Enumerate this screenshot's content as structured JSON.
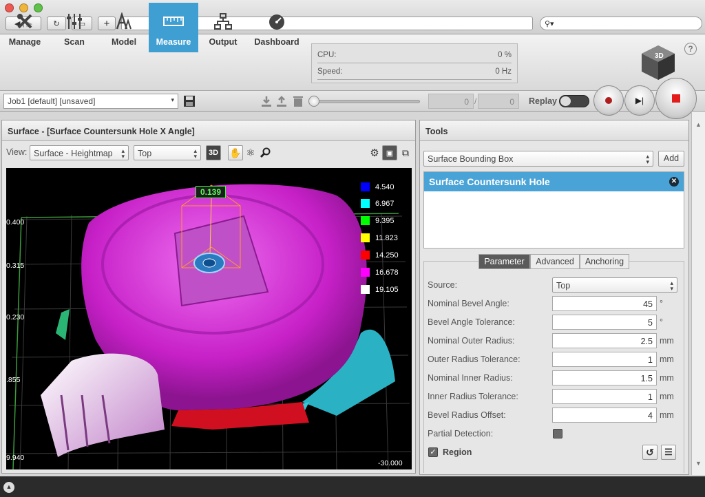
{
  "toolbar": {
    "items": [
      {
        "label": "Manage",
        "icon": "wrench-screwdriver-icon"
      },
      {
        "label": "Scan",
        "icon": "sliders-icon"
      },
      {
        "label": "Model",
        "icon": "font-model-icon"
      },
      {
        "label": "Measure",
        "icon": "ruler-icon"
      },
      {
        "label": "Output",
        "icon": "network-icon"
      },
      {
        "label": "Dashboard",
        "icon": "gauge-icon"
      }
    ],
    "active": "Measure",
    "cpu_label": "CPU:",
    "cpu_value": "0 %",
    "speed_label": "Speed:",
    "speed_value": "0 Hz",
    "help": "?",
    "logo": "3D"
  },
  "jobbar": {
    "job": "Job1 [default] [unsaved]",
    "frame_current": "0",
    "separator": "/",
    "frame_total": "0",
    "replay_label": "Replay"
  },
  "surface_panel": {
    "title": "Surface - [Surface Countersunk Hole X Angle]",
    "view_label": "View:",
    "view_mode": "Surface - Heightmap",
    "view_dir": "Top",
    "btn_3d": "3D",
    "measurement_value": "0.139",
    "legend": [
      {
        "value": "4.540",
        "color": "#0000ff"
      },
      {
        "value": "6.967",
        "color": "#00ffff"
      },
      {
        "value": "9.395",
        "color": "#00ff00"
      },
      {
        "value": "11.823",
        "color": "#ffff00"
      },
      {
        "value": "14.250",
        "color": "#ff0000"
      },
      {
        "value": "16.678",
        "color": "#ff00ff"
      },
      {
        "value": "19.105",
        "color": "#ffffff"
      }
    ],
    "axis_labels": [
      "0.400",
      "0.315",
      "0.230",
      ".855",
      "9.940"
    ],
    "axis_right": "-30.000"
  },
  "tools_panel": {
    "title": "Tools",
    "tool_select": "Surface Bounding Box",
    "add_label": "Add",
    "selected_tool": "Surface Countersunk Hole",
    "tabs": [
      "Parameter",
      "Advanced",
      "Anchoring"
    ],
    "active_tab": "Parameter",
    "source_label": "Source:",
    "source_value": "Top",
    "params": [
      {
        "label": "Nominal Bevel Angle:",
        "value": "45",
        "unit": "°"
      },
      {
        "label": "Bevel Angle Tolerance:",
        "value": "5",
        "unit": "°"
      },
      {
        "label": "Nominal Outer Radius:",
        "value": "2.5",
        "unit": "mm"
      },
      {
        "label": "Outer Radius Tolerance:",
        "value": "1",
        "unit": "mm"
      },
      {
        "label": "Nominal Inner Radius:",
        "value": "1.5",
        "unit": "mm"
      },
      {
        "label": "Inner Radius Tolerance:",
        "value": "1",
        "unit": "mm"
      },
      {
        "label": "Bevel Radius Offset:",
        "value": "4",
        "unit": "mm"
      }
    ],
    "partial_label": "Partial Detection:",
    "region_label": "Region",
    "region_checked": true
  },
  "colors": {
    "accent": "#3f9fd3",
    "selected_tool_bg": "#4aa3d6"
  }
}
